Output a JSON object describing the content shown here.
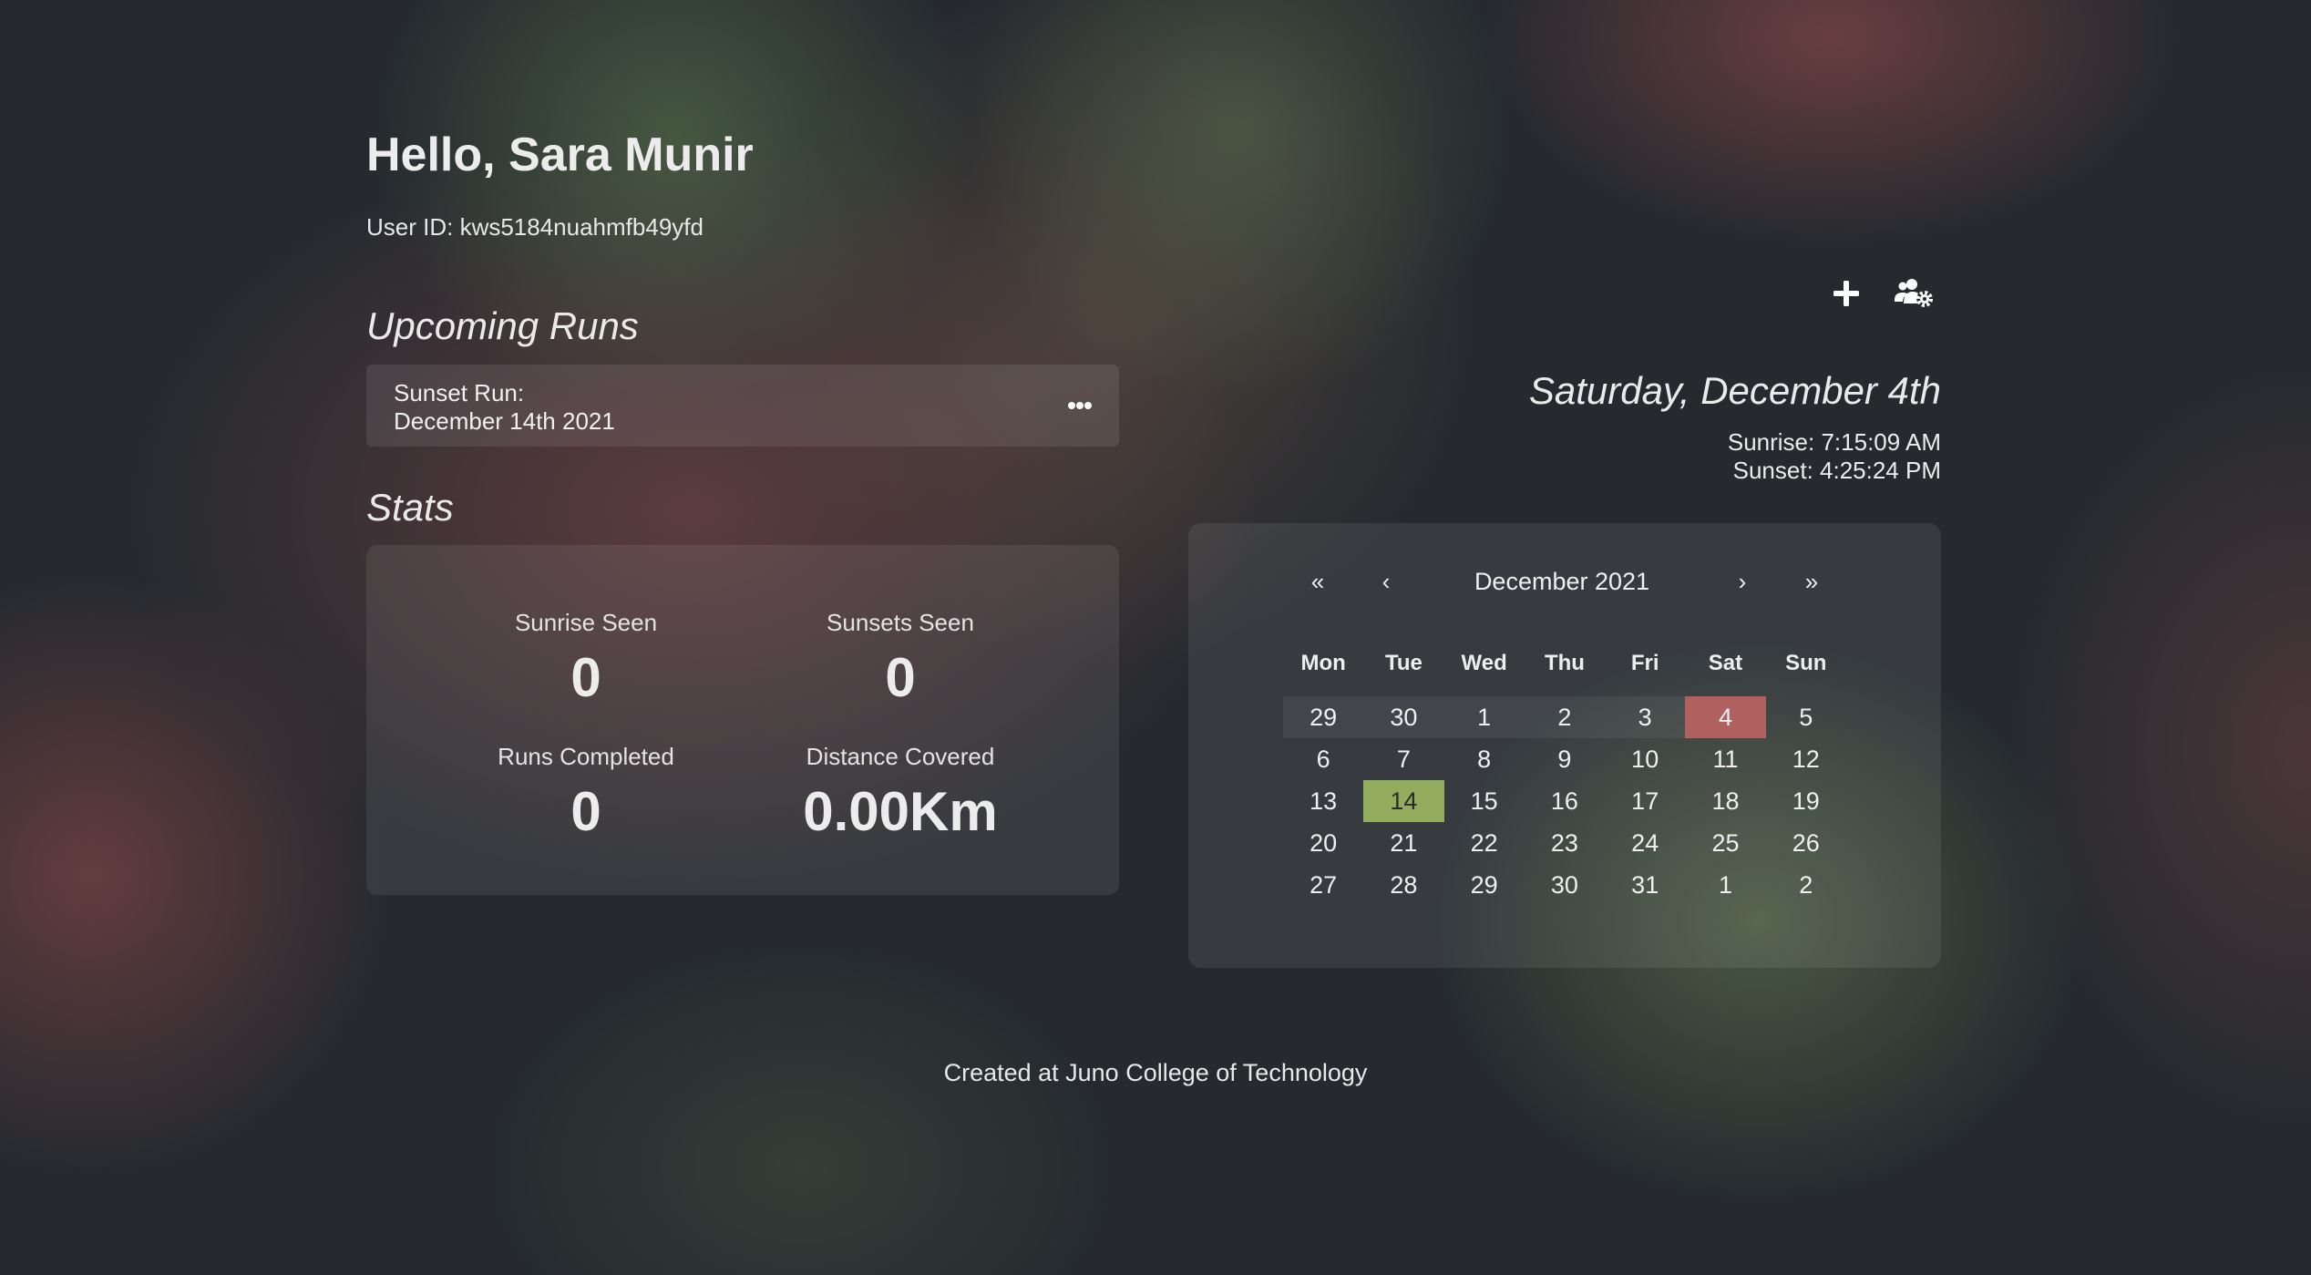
{
  "header": {
    "greeting": "Hello, Sara Munir",
    "user_id_label": "User ID: kws5184nuahmfb49yfd"
  },
  "upcoming_runs": {
    "title": "Upcoming Runs",
    "runs": [
      {
        "name": "Sunset Run:",
        "date": "December 14th 2021"
      }
    ]
  },
  "stats": {
    "title": "Stats",
    "items": [
      {
        "label": "Sunrise Seen",
        "value": "0"
      },
      {
        "label": "Sunsets Seen",
        "value": "0"
      },
      {
        "label": "Runs Completed",
        "value": "0"
      },
      {
        "label": "Distance Covered",
        "value": "0.00Km"
      }
    ]
  },
  "toolbar": {
    "add_icon": "plus-icon",
    "settings_icon": "users-cog-icon"
  },
  "today": {
    "date": "Saturday, December 4th",
    "sunrise": "Sunrise: 7:15:09 AM",
    "sunset": "Sunset: 4:25:24 PM"
  },
  "calendar": {
    "first_label": "«",
    "prev_label": "‹",
    "month_label": "December 2021",
    "next_label": "›",
    "last_label": "»",
    "weekdays": [
      "Mon",
      "Tue",
      "Wed",
      "Thu",
      "Fri",
      "Sat",
      "Sun"
    ],
    "weeks": [
      [
        "29",
        "30",
        "1",
        "2",
        "3",
        "4",
        "5"
      ],
      [
        "6",
        "7",
        "8",
        "9",
        "10",
        "11",
        "12"
      ],
      [
        "13",
        "14",
        "15",
        "16",
        "17",
        "18",
        "19"
      ],
      [
        "20",
        "21",
        "22",
        "23",
        "24",
        "25",
        "26"
      ],
      [
        "27",
        "28",
        "29",
        "30",
        "31",
        "1",
        "2"
      ]
    ],
    "today_color": "#b0605e",
    "run_day_color": "#93ab5d"
  },
  "footer": {
    "text": "Created at Juno College of Technology"
  }
}
